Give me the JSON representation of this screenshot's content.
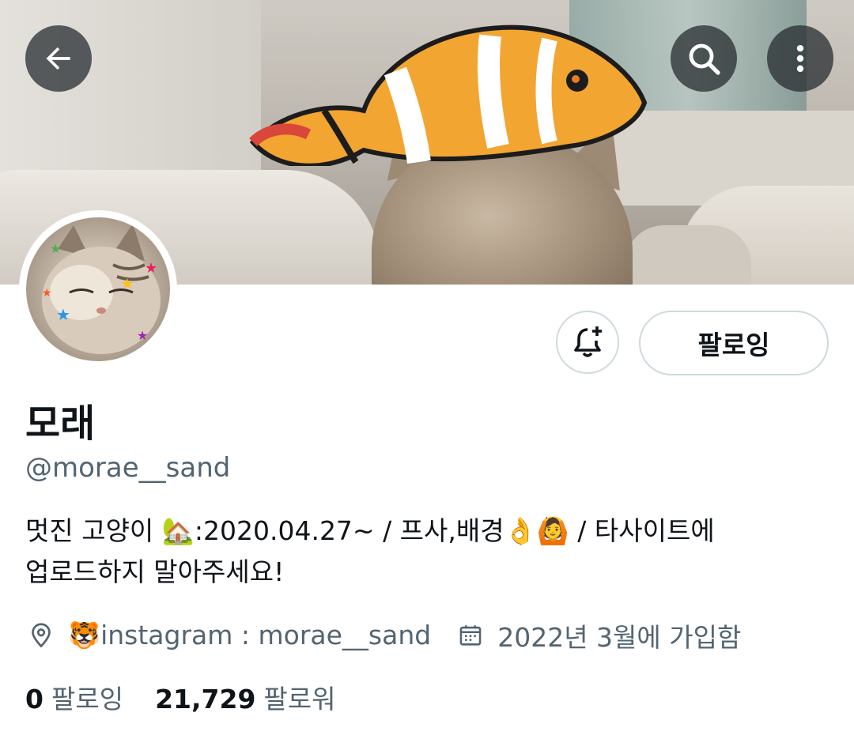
{
  "header": {
    "back_icon": "arrow-left-icon",
    "search_icon": "search-icon",
    "more_icon": "more-vertical-icon"
  },
  "profile": {
    "follow_button_label": "팔로잉",
    "notify_icon": "bell-plus-icon",
    "display_name": "모래",
    "handle": "@morae__sand",
    "bio_line1": "멋진 고양이 🏡:2020.04.27~ / 프사,배경👌🙆 / 타사이트에",
    "bio_line2": "업로드하지 말아주세요!",
    "location_icon": "location-pin-icon",
    "location_text": "🐯instagram : morae__sand",
    "joined_icon": "calendar-icon",
    "joined_text": "2022년 3월에 가입함",
    "following_count": "0",
    "following_label": "팔로잉",
    "followers_count": "21,729",
    "followers_label": "팔로워"
  },
  "colors": {
    "text_primary": "#0f1419",
    "text_secondary": "#536471",
    "border": "#cfd9de",
    "overlay_button": "#272c30"
  }
}
